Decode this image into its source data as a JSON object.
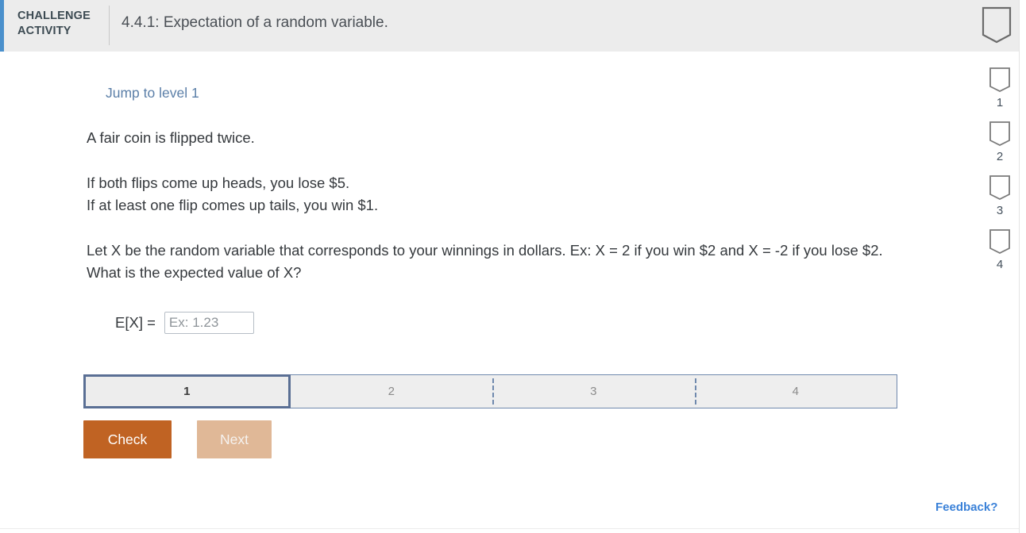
{
  "header": {
    "activity_label_line1": "CHALLENGE",
    "activity_label_line2": "ACTIVITY",
    "title": "4.4.1: Expectation of a random variable.",
    "bookmark_icon": "bookmark-icon",
    "accent_color": "#4a90cc",
    "background_color": "#ececec"
  },
  "rail": {
    "items": [
      {
        "icon": "bookmark-icon",
        "number": "1"
      },
      {
        "icon": "bookmark-icon",
        "number": "2"
      },
      {
        "icon": "bookmark-icon",
        "number": "3"
      },
      {
        "icon": "bookmark-icon",
        "number": "4"
      }
    ]
  },
  "main": {
    "jump_link": "Jump to level 1",
    "prompt_line1": "A fair coin is flipped twice.",
    "prompt_line2": "If both flips come up heads, you lose $5.",
    "prompt_line3": "If at least one flip comes up tails, you win $1.",
    "prompt_line4": "Let X be the random variable that corresponds to your winnings in dollars. Ex: X = 2 if you win $2 and X = -2 if you lose $2. What is the expected value of X?",
    "answer_label": "E[X] =",
    "answer_value": "",
    "answer_placeholder": "Ex: 1.23"
  },
  "progress": {
    "tabs": [
      {
        "label": "1",
        "active": true
      },
      {
        "label": "2",
        "active": false
      },
      {
        "label": "3",
        "active": false
      },
      {
        "label": "4",
        "active": false
      }
    ],
    "active_border_color": "#5a6f94",
    "border_color": "#6f89ad"
  },
  "actions": {
    "check_label": "Check",
    "check_color": "#c06323",
    "next_label": "Next",
    "next_color": "#e0b897"
  },
  "footer": {
    "feedback_label": "Feedback?",
    "feedback_color": "#3a81d8"
  }
}
